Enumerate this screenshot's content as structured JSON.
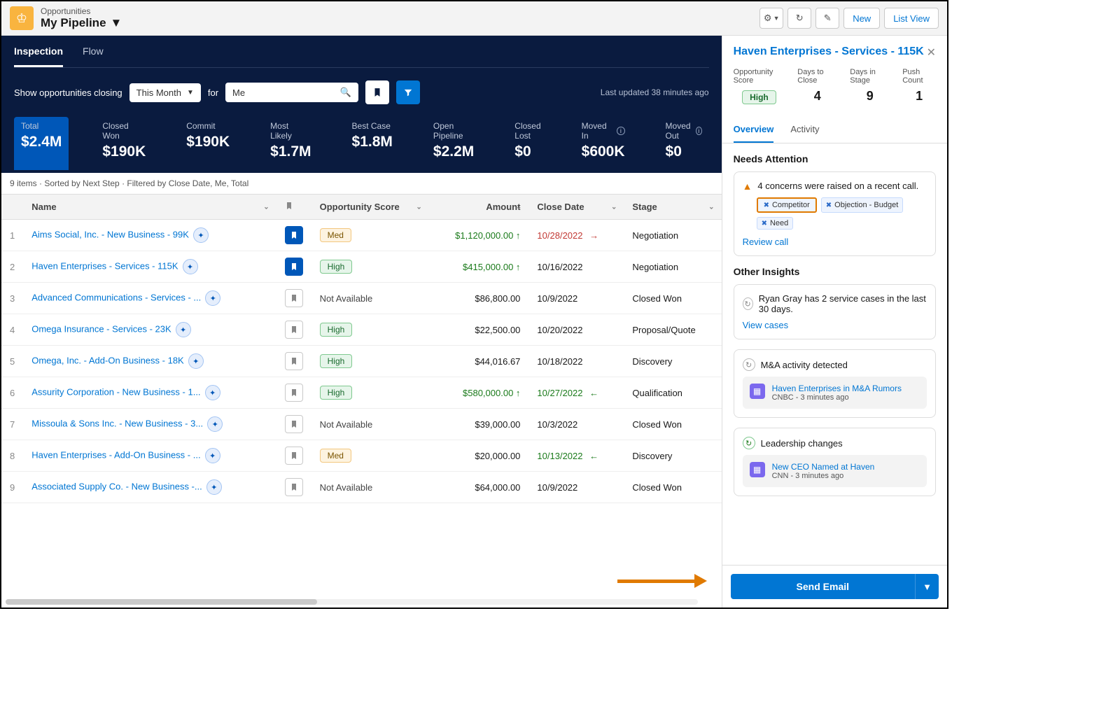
{
  "header": {
    "breadcrumb": "Opportunities",
    "title": "My Pipeline",
    "buttons": {
      "new": "New",
      "listView": "List View"
    }
  },
  "tabs": {
    "inspection": "Inspection",
    "flow": "Flow"
  },
  "filters": {
    "label": "Show opportunities closing",
    "period": "This Month",
    "for": "for",
    "owner": "Me",
    "updated": "Last updated 38 minutes ago"
  },
  "metrics": [
    {
      "label": "Total",
      "value": "$2.4M",
      "active": true
    },
    {
      "label": "Closed Won",
      "value": "$190K"
    },
    {
      "label": "Commit",
      "value": "$190K"
    },
    {
      "label": "Most Likely",
      "value": "$1.7M"
    },
    {
      "label": "Best Case",
      "value": "$1.8M"
    },
    {
      "label": "Open Pipeline",
      "value": "$2.2M"
    },
    {
      "label": "Closed Lost",
      "value": "$0"
    },
    {
      "label": "Moved In",
      "value": "$600K",
      "info": true
    },
    {
      "label": "Moved Out",
      "value": "$0",
      "info": true
    }
  ],
  "tableMeta": "9 items · Sorted by Next Step · Filtered by Close Date, Me, Total",
  "columns": {
    "name": "Name",
    "score": "Opportunity Score",
    "amount": "Amount",
    "close": "Close Date",
    "stage": "Stage"
  },
  "rows": [
    {
      "n": "1",
      "name": "Aims Social, Inc. - New Business - 99K",
      "bm": true,
      "score": "Med",
      "scoreClass": "med",
      "amount": "$1,120,000.00",
      "amtTrend": "up",
      "date": "10/28/2022",
      "dateClass": "red",
      "dateArrow": "right",
      "stage": "Negotiation"
    },
    {
      "n": "2",
      "name": "Haven Enterprises - Services - 115K",
      "bm": true,
      "score": "High",
      "scoreClass": "high",
      "amount": "$415,000.00",
      "amtTrend": "up",
      "date": "10/16/2022",
      "stage": "Negotiation"
    },
    {
      "n": "3",
      "name": "Advanced Communications - Services - ...",
      "bm": false,
      "score": "Not Available",
      "amount": "$86,800.00",
      "date": "10/9/2022",
      "stage": "Closed Won"
    },
    {
      "n": "4",
      "name": "Omega Insurance - Services - 23K",
      "bm": false,
      "score": "High",
      "scoreClass": "high",
      "amount": "$22,500.00",
      "date": "10/20/2022",
      "stage": "Proposal/Quote"
    },
    {
      "n": "5",
      "name": "Omega, Inc. - Add-On Business - 18K",
      "bm": false,
      "score": "High",
      "scoreClass": "high",
      "amount": "$44,016.67",
      "date": "10/18/2022",
      "stage": "Discovery"
    },
    {
      "n": "6",
      "name": "Assurity Corporation - New Business - 1...",
      "bm": false,
      "score": "High",
      "scoreClass": "high",
      "amount": "$580,000.00",
      "amtTrend": "up",
      "date": "10/27/2022",
      "dateClass": "green",
      "dateArrow": "left",
      "stage": "Qualification"
    },
    {
      "n": "7",
      "name": "Missoula & Sons Inc. - New Business - 3...",
      "bm": false,
      "score": "Not Available",
      "amount": "$39,000.00",
      "date": "10/3/2022",
      "stage": "Closed Won"
    },
    {
      "n": "8",
      "name": "Haven Enterprises - Add-On Business - ...",
      "bm": false,
      "score": "Med",
      "scoreClass": "med",
      "amount": "$20,000.00",
      "date": "10/13/2022",
      "dateClass": "green",
      "dateArrow": "left",
      "stage": "Discovery"
    },
    {
      "n": "9",
      "name": "Associated Supply Co. - New Business -...",
      "bm": false,
      "score": "Not Available",
      "amount": "$64,000.00",
      "date": "10/9/2022",
      "stage": "Closed Won"
    }
  ],
  "panel": {
    "title": "Haven Enterprises - Services - 115K",
    "metrics": [
      {
        "lbl": "Opportunity Score",
        "val": "High",
        "pill": true
      },
      {
        "lbl": "Days to Close",
        "val": "4"
      },
      {
        "lbl": "Days in Stage",
        "val": "9"
      },
      {
        "lbl": "Push Count",
        "val": "1"
      }
    ],
    "tabs": {
      "overview": "Overview",
      "activity": "Activity"
    },
    "needs": {
      "title": "Needs Attention",
      "concern": "4 concerns were raised on a recent call.",
      "tags": [
        "Competitor",
        "Objection - Budget",
        "Need"
      ],
      "review": "Review call"
    },
    "other": {
      "title": "Other Insights",
      "insight1": {
        "text": "Ryan Gray has 2 service cases in the last 30 days.",
        "link": "View cases"
      },
      "insight2": {
        "head": "M&A activity detected",
        "newsTitle": "Haven Enterprises in M&A Rumors",
        "newsMeta": "CNBC - 3 minutes ago"
      },
      "insight3": {
        "head": "Leadership changes",
        "newsTitle": "New CEO Named at Haven",
        "newsMeta": "CNN - 3 minutes ago"
      }
    },
    "sendBtn": "Send Email"
  }
}
